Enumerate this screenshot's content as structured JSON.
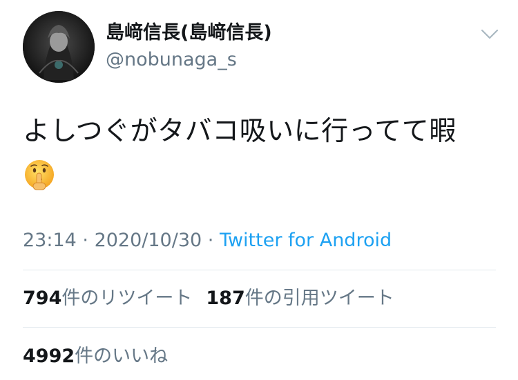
{
  "user": {
    "display_name": "島﨑信長(島﨑信長)",
    "handle": "@nobunaga_s"
  },
  "tweet": {
    "text": "よしつぐがタバコ吸いに行ってて暇",
    "emoji": "shushing-face-emoji"
  },
  "meta": {
    "time": "23:14",
    "separator1": " · ",
    "date": "2020/10/30",
    "separator2": " · ",
    "source": "Twitter for Android"
  },
  "stats": {
    "retweets": {
      "count": "794",
      "label": "件のリツイート"
    },
    "quotes": {
      "count": "187",
      "label": "件の引用ツイート"
    },
    "likes": {
      "count": "4992",
      "label": "件のいいね"
    }
  },
  "icons": {
    "menu": "chevron-down-icon"
  },
  "colors": {
    "text": "#14171a",
    "secondary": "#657786",
    "link": "#1da1f2",
    "divider": "#e1e8ed"
  }
}
